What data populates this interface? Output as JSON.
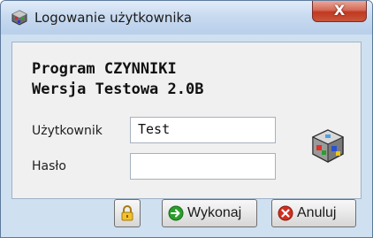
{
  "window": {
    "title": "Logowanie użytkownika",
    "close_glyph": "X"
  },
  "program": {
    "name": "Program CZYNNIKI",
    "version": "Wersja Testowa 2.0B"
  },
  "form": {
    "user_label": "Użytkownik",
    "user_value": "Test",
    "password_label": "Hasło",
    "password_value": ""
  },
  "buttons": {
    "lock_icon": "padlock-icon",
    "ok_label": "Wykonaj",
    "ok_icon": "green-arrow-icon",
    "cancel_label": "Anuluj",
    "cancel_icon": "red-x-icon"
  },
  "colors": {
    "title_bar": "#c6d9ef",
    "close_button": "#c0391f",
    "panel": "#f0f0f0",
    "ok_accent": "#2a9d2a",
    "cancel_accent": "#d03020"
  }
}
